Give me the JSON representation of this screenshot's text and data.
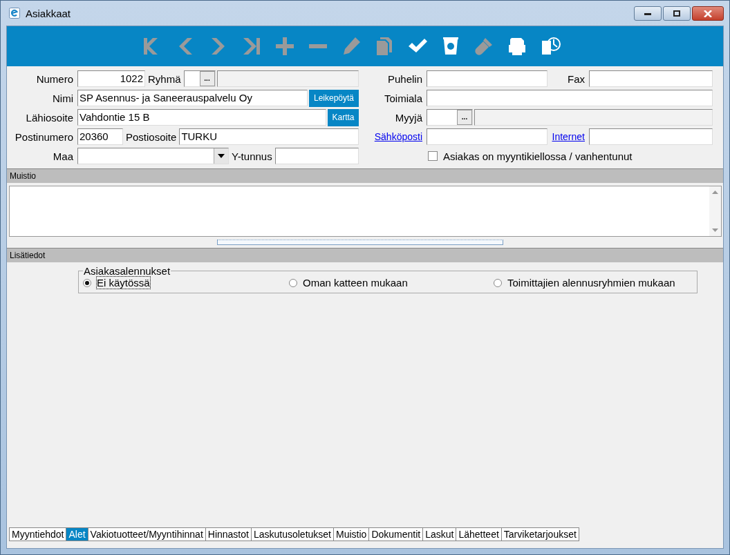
{
  "window": {
    "title": "Asiakkaat"
  },
  "toolbar": [
    {
      "kind": "first",
      "disabled": true
    },
    {
      "kind": "prev",
      "disabled": true
    },
    {
      "kind": "next",
      "disabled": true
    },
    {
      "kind": "last",
      "disabled": true
    },
    {
      "kind": "add",
      "disabled": true
    },
    {
      "kind": "remove",
      "disabled": true
    },
    {
      "kind": "edit",
      "disabled": true
    },
    {
      "kind": "copy",
      "disabled": true
    },
    {
      "kind": "save",
      "disabled": false
    },
    {
      "kind": "bin",
      "disabled": false
    },
    {
      "kind": "torch",
      "disabled": true
    },
    {
      "kind": "print",
      "disabled": false
    },
    {
      "kind": "export",
      "disabled": false
    }
  ],
  "form_left": {
    "numero": {
      "label": "Numero",
      "value": "1022"
    },
    "ryhma": {
      "label": "Ryhmä",
      "button": "..."
    },
    "nimi": {
      "label": "Nimi",
      "value": "SP Asennus- ja Saneerauspalvelu Oy",
      "button": "Leikepöytä"
    },
    "lahiosoite": {
      "label": "Lähiosoite",
      "value": "Vahdontie 15 B",
      "button": "Kartta"
    },
    "postinumero": {
      "label": "Postinumero",
      "value": "20360"
    },
    "postiosoite": {
      "label": "Postiosoite",
      "value": "TURKU"
    },
    "maa": {
      "label": "Maa"
    },
    "ytunnus": {
      "label": "Y-tunnus"
    }
  },
  "form_right": {
    "puhelin": {
      "label": "Puhelin"
    },
    "fax": {
      "label": "Fax"
    },
    "toimiala": {
      "label": "Toimiala"
    },
    "myyja": {
      "label": "Myyjä",
      "button": "..."
    },
    "sahkoposti": {
      "label": "Sähköposti"
    },
    "internet": {
      "label": "Internet"
    },
    "blocked": {
      "label": "Asiakas on myyntikiellossa / vanhentunut",
      "checked": false
    }
  },
  "memo": {
    "title": "Muistio"
  },
  "details": {
    "title": "Lisätiedot",
    "group": "Asiakasalennukset",
    "options": [
      {
        "label": "Ei käytössä",
        "selected": true
      },
      {
        "label": "Oman katteen mukaan",
        "selected": false
      },
      {
        "label": "Toimittajien alennusryhmien mukaan",
        "selected": false
      }
    ]
  },
  "tabs": [
    {
      "label": "Myyntiehdot",
      "selected": false
    },
    {
      "label": "Alet",
      "selected": true
    },
    {
      "label": "Vakiotuotteet/Myyntihinnat",
      "selected": false
    },
    {
      "label": "Hinnastot",
      "selected": false
    },
    {
      "label": "Laskutusoletukset",
      "selected": false
    },
    {
      "label": "Muistio",
      "selected": false
    },
    {
      "label": "Dokumentit",
      "selected": false
    },
    {
      "label": "Laskut",
      "selected": false
    },
    {
      "label": "Lähetteet",
      "selected": false
    },
    {
      "label": "Tarviketarjoukset",
      "selected": false
    }
  ]
}
